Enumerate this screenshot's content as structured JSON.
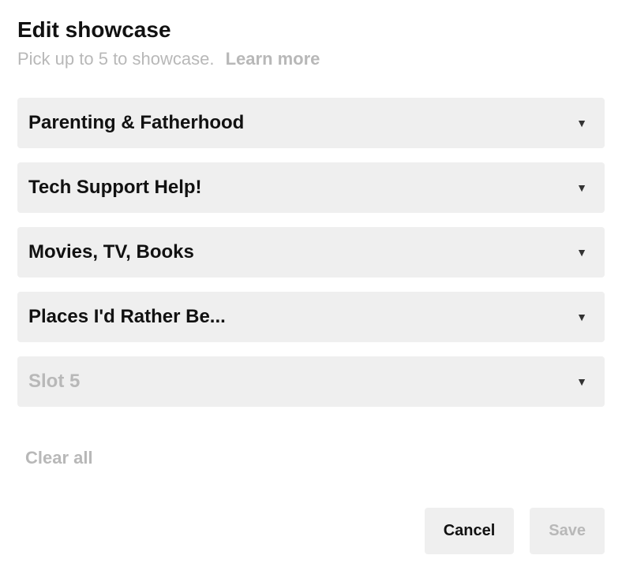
{
  "header": {
    "title": "Edit showcase",
    "subtitle": "Pick up to 5 to showcase.",
    "learn_more": "Learn more"
  },
  "slots": [
    {
      "label": "Parenting & Fatherhood",
      "empty": false
    },
    {
      "label": "Tech Support Help!",
      "empty": false
    },
    {
      "label": "Movies, TV, Books",
      "empty": false
    },
    {
      "label": "Places I'd Rather Be...",
      "empty": false
    },
    {
      "label": "Slot 5",
      "empty": true
    }
  ],
  "actions": {
    "clear_all": "Clear all",
    "cancel": "Cancel",
    "save": "Save"
  },
  "icons": {
    "dropdown": "▼"
  }
}
